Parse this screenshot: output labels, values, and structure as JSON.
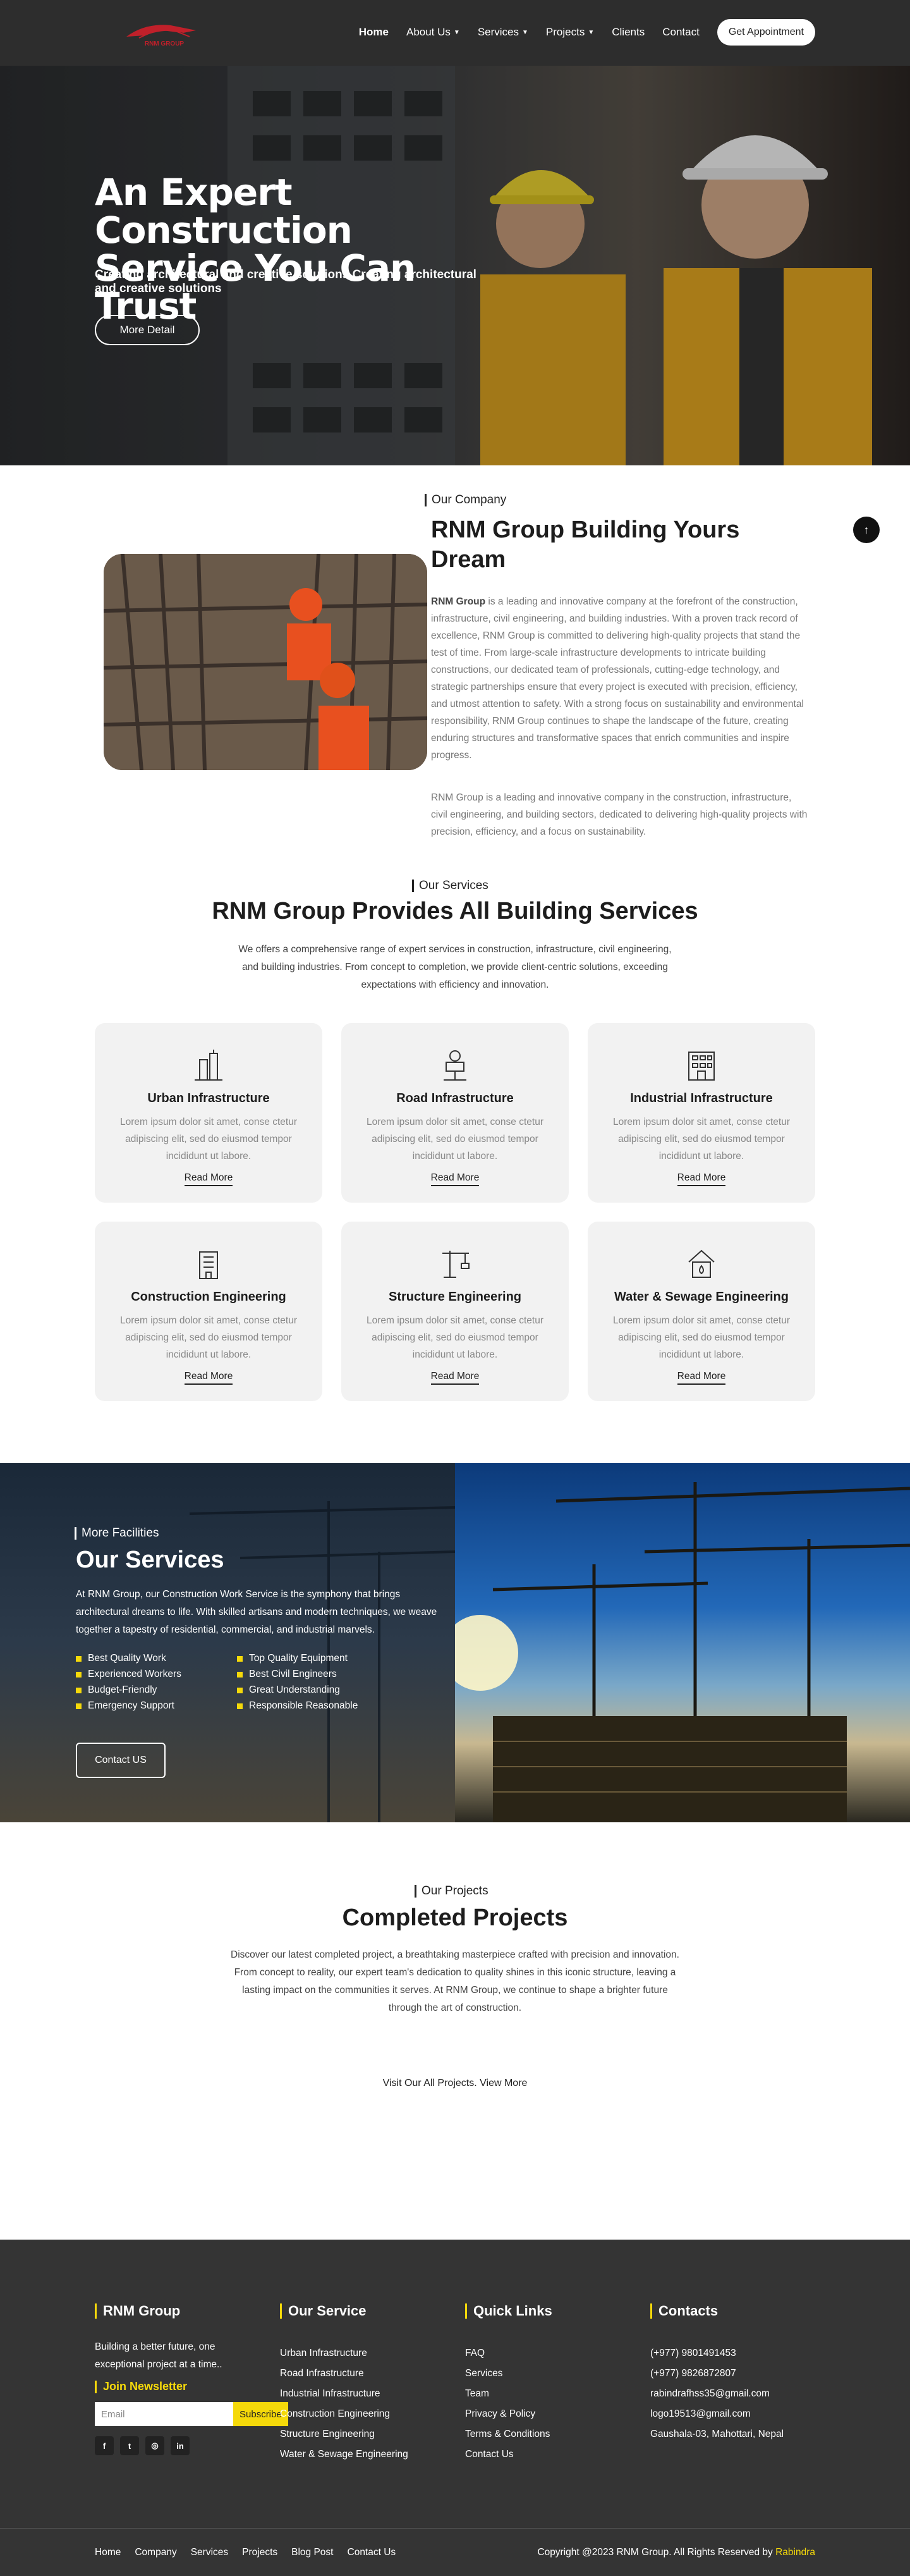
{
  "header": {
    "logo_text": "RNM GROUP",
    "nav": [
      {
        "label": "Home",
        "active": true,
        "dropdown": false
      },
      {
        "label": "About Us",
        "active": false,
        "dropdown": true
      },
      {
        "label": "Services",
        "active": false,
        "dropdown": true
      },
      {
        "label": "Projects",
        "active": false,
        "dropdown": true
      },
      {
        "label": "Clients",
        "active": false,
        "dropdown": false
      },
      {
        "label": "Contact",
        "active": false,
        "dropdown": false
      }
    ],
    "cta": "Get Appointment"
  },
  "hero": {
    "title": "An Expert Construction Service You Can Trust",
    "subtitle": "Creating architectural and creative solutions Creating architectural and creative solutions",
    "button": "More Detail"
  },
  "about": {
    "kicker": "Our Company",
    "title": "RNM Group Building Yours Dream",
    "p1_bold": "RNM Group",
    "p1_rest": " is a leading and innovative company at the forefront of the construction, infrastructure, civil engineering, and building industries. With a proven track record of excellence, RNM Group is committed to delivering high-quality projects that stand the test of time. From large-scale infrastructure developments to intricate building constructions, our dedicated team of professionals, cutting-edge technology, and strategic partnerships ensure that every project is executed with precision, efficiency, and utmost attention to safety. With a strong focus on sustainability and environmental responsibility, RNM Group continues to shape the landscape of the future, creating enduring structures and transformative spaces that enrich communities and inspire progress.",
    "p2": "RNM Group is a leading and innovative company in the construction, infrastructure, civil engineering, and building sectors, dedicated to delivering high-quality projects with precision, efficiency, and a focus on sustainability."
  },
  "services": {
    "kicker": "Our Services",
    "title": "RNM Group Provides All Building Services",
    "description": "We offers a comprehensive range of expert services in construction, infrastructure, civil engineering, and building industries. From concept to completion, we provide client-centric solutions, exceeding expectations with efficiency and innovation.",
    "cards": [
      {
        "name": "Urban Infrastructure",
        "icon": "urban-tower-icon",
        "text": "Lorem ipsum dolor sit amet, conse ctetur adipiscing elit, sed do eiusmod tempor incididunt ut labore.",
        "link": "Read More"
      },
      {
        "name": "Road Infrastructure",
        "icon": "road-building-icon",
        "text": "Lorem ipsum dolor sit amet, conse ctetur adipiscing elit, sed do eiusmod tempor incididunt ut labore.",
        "link": "Read More"
      },
      {
        "name": "Industrial Infrastructure",
        "icon": "industrial-building-icon",
        "text": "Lorem ipsum dolor sit amet, conse ctetur adipiscing elit, sed do eiusmod tempor incididunt ut labore.",
        "link": "Read More"
      },
      {
        "name": "Construction Engineering",
        "icon": "construction-building-icon",
        "text": "Lorem ipsum dolor sit amet, conse ctetur adipiscing elit, sed do eiusmod tempor incididunt ut labore.",
        "link": "Read More"
      },
      {
        "name": "Structure Engineering",
        "icon": "crane-icon",
        "text": "Lorem ipsum dolor sit amet, conse ctetur adipiscing elit, sed do eiusmod tempor incididunt ut labore.",
        "link": "Read More"
      },
      {
        "name": "Water & Sewage Engineering",
        "icon": "water-house-icon",
        "text": "Lorem ipsum dolor sit amet, conse ctetur adipiscing elit, sed do eiusmod tempor incididunt ut labore.",
        "link": "Read More"
      }
    ]
  },
  "facilities": {
    "kicker": "More Facilities",
    "title": "Our Services",
    "description": "At RNM Group, our Construction Work Service is the symphony that brings architectural dreams to life. With skilled artisans and modern techniques, we weave together a tapestry of residential, commercial, and industrial marvels.",
    "items": [
      "Best Quality Work",
      "Top Quality Equipment",
      "Experienced Workers",
      "Best Civil Engineers",
      "Budget-Friendly",
      "Great Understanding",
      "Emergency Support",
      "Responsible Reasonable"
    ],
    "button": "Contact US"
  },
  "projects": {
    "kicker": "Our Projects",
    "title": "Completed Projects",
    "description": "Discover our latest completed project, a breathtaking masterpiece crafted with precision and innovation. From concept to reality, our expert team's dedication to quality shines in this iconic structure, leaving a lasting impact on the communities it serves. At RNM Group, we continue to shape a brighter future through the art of construction.",
    "link_prefix": "Visit Our All Projects.",
    "link_label": "View More"
  },
  "footer": {
    "brand": "RNM Group",
    "about": "Building a better future, one exceptional project at a time..",
    "newsletter": "Join Newsletter",
    "email_placeholder": "Email",
    "subscribe": "Subscribe",
    "social": [
      {
        "name": "facebook-icon",
        "glyph": "f"
      },
      {
        "name": "twitter-icon",
        "glyph": "t"
      },
      {
        "name": "instagram-icon",
        "glyph": "◎"
      },
      {
        "name": "linkedin-icon",
        "glyph": "in"
      }
    ],
    "service_head": "Our Service",
    "service_links": [
      "Urban Infrastructure",
      "Road Infrastructure",
      "Industrial Infrastructure",
      "Construction Engineering",
      "Structure Engineering",
      "Water & Sewage Engineering"
    ],
    "quick_head": "Quick Links",
    "quick_links": [
      "FAQ",
      "Services",
      "Team",
      "Privacy & Policy",
      "Terms & Conditions",
      "Contact Us"
    ],
    "contact_head": "Contacts",
    "contacts": [
      "(+977) 9801491453",
      "(+977) 9826872807",
      "rabindrafhss35@gmail.com",
      "logo19513@gmail.com",
      "Gaushala-03, Mahottari, Nepal"
    ],
    "bottom_links": [
      "Home",
      "Company",
      "Services",
      "Projects",
      "Blog Post",
      "Contact Us"
    ],
    "copyright": "Copyright @2023 RNM Group. All Rights Reserved by",
    "author": "Rabindra"
  },
  "colors": {
    "accent": "#f5d90a",
    "dark": "#343434",
    "header": "#2d2d2d"
  }
}
